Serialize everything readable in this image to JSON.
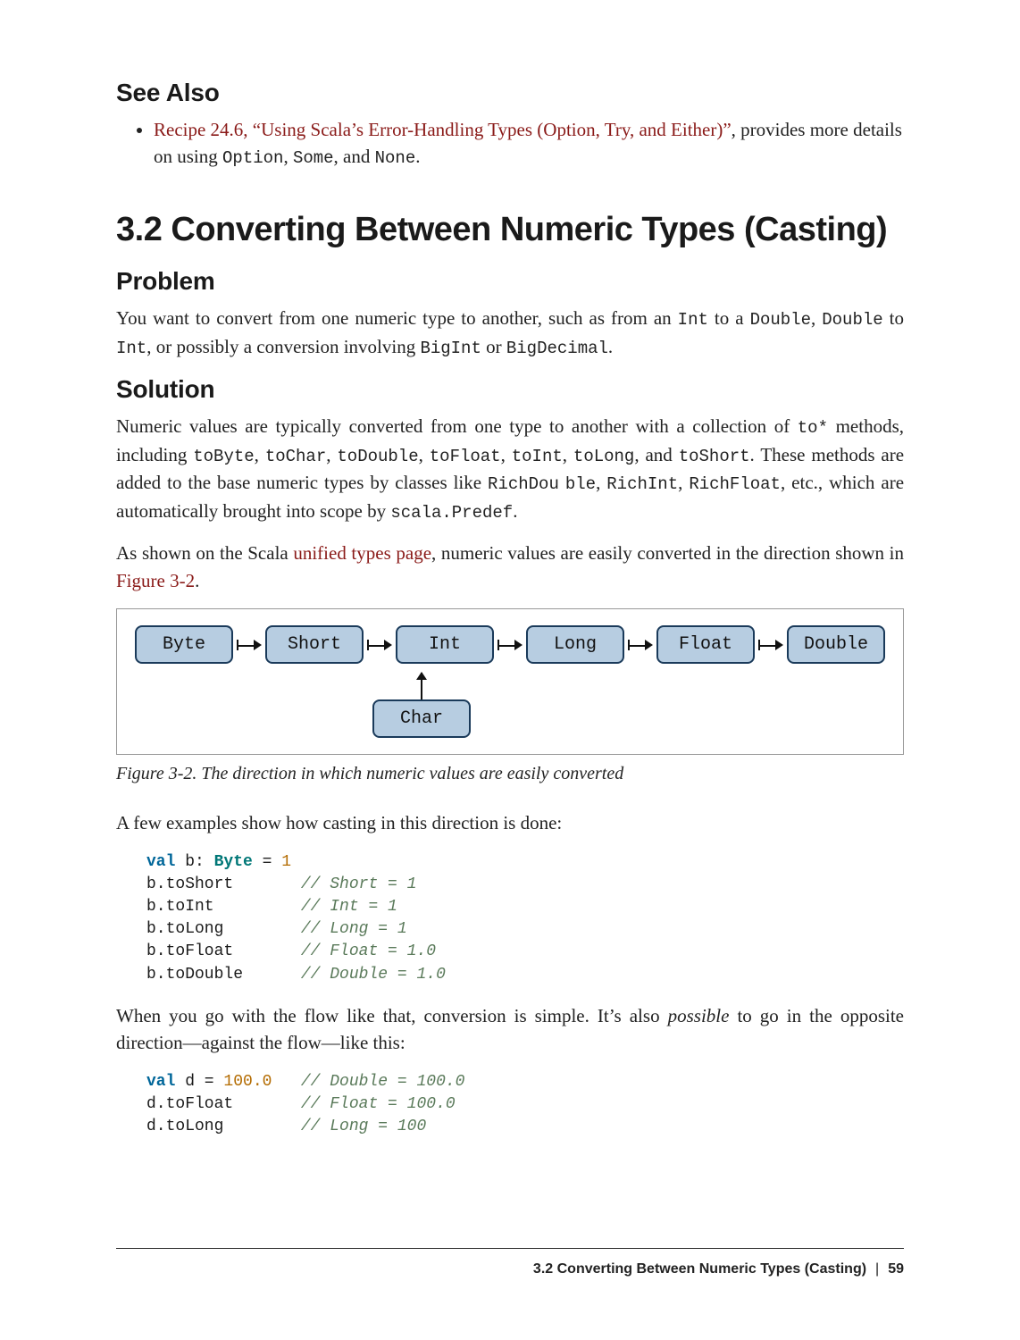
{
  "see_also": {
    "heading": "See Also",
    "item_link": "Recipe 24.6, “Using Scala’s Error-Handling Types (Option, Try, and Either)”",
    "item_tail_1": ", provides more details on using ",
    "code1": "Option",
    "sep1": ", ",
    "code2": "Some",
    "sep2": ", and ",
    "code3": "None",
    "tail_end": "."
  },
  "section": {
    "title": "3.2 Converting Between Numeric Types (Casting)"
  },
  "problem": {
    "heading": "Problem",
    "p1a": "You want to convert from one numeric type to another, such as from an ",
    "c1": "Int",
    "p1b": " to a ",
    "c2": "Double",
    "p1c": ", ",
    "c3": "Double",
    "p1d": " to ",
    "c4": "Int",
    "p1e": ", or possibly a conversion involving ",
    "c5": "BigInt",
    "p1f": " or ",
    "c6": "BigDecimal",
    "p1g": "."
  },
  "solution": {
    "heading": "Solution",
    "p1a": "Numeric values are typically converted from one type to another with a collection of ",
    "c_tostar": "to*",
    "p1b": " methods, including ",
    "c1": "toByte",
    "s1": ", ",
    "c2": "toChar",
    "s2": ", ",
    "c3": "toDouble",
    "s3": ", ",
    "c4": "toFloat",
    "s4": ", ",
    "c5": "toInt",
    "s5": ", ",
    "c6": "toLong",
    "s6": ", and ",
    "c7": "toShort",
    "p1c": ". These methods are added to the base numeric types by classes like ",
    "c8": "RichDou",
    "c8b": "ble",
    "s8": ", ",
    "c9": "RichInt",
    "s9": ", ",
    "c10": "RichFloat",
    "p1d": ", etc., which are automatically brought into scope by ",
    "c11": "scala.Predef",
    "p1e": ".",
    "p2a": "As shown on the Scala ",
    "link1": "unified types page",
    "p2b": ", numeric values are easily converted in the direction shown in ",
    "link2": "Figure 3-2",
    "p2c": "."
  },
  "figure": {
    "types": [
      "Byte",
      "Short",
      "Int",
      "Long",
      "Float",
      "Double"
    ],
    "char": "Char",
    "caption": "Figure 3-2. The direction in which numeric values are easily converted"
  },
  "casting_intro": "A few examples show how casting in this direction is done:",
  "code1": {
    "l1_kw": "val",
    "l1_nm": " b",
    "l1_colon": ": ",
    "l1_tp": "Byte",
    "l1_eq": " = ",
    "l1_num": "1",
    "l2_nm": "b.toShort",
    "l2_pad": "       ",
    "l2_cm": "// Short = 1",
    "l3_nm": "b.toInt",
    "l3_pad": "         ",
    "l3_cm": "// Int = 1",
    "l4_nm": "b.toLong",
    "l4_pad": "        ",
    "l4_cm": "// Long = 1",
    "l5_nm": "b.toFloat",
    "l5_pad": "       ",
    "l5_cm": "// Float = 1.0",
    "l6_nm": "b.toDouble",
    "l6_pad": "      ",
    "l6_cm": "// Double = 1.0"
  },
  "flow_para": {
    "a": "When you go with the flow like that, conversion is simple. It’s also ",
    "it": "possible",
    "b": " to go in the opposite direction—against the flow—like this:"
  },
  "code2": {
    "l1_kw": "val",
    "l1_nm": " d = ",
    "l1_num": "100.0",
    "l1_pad": "   ",
    "l1_cm": "// Double = 100.0",
    "l2_nm": "d.toFloat",
    "l2_pad": "       ",
    "l2_cm": "// Float = 100.0",
    "l3_nm": "d.toLong",
    "l3_pad": "        ",
    "l3_cm": "// Long = 100"
  },
  "footer": {
    "title": "3.2 Converting Between Numeric Types (Casting)",
    "sep": "|",
    "page": "59"
  }
}
